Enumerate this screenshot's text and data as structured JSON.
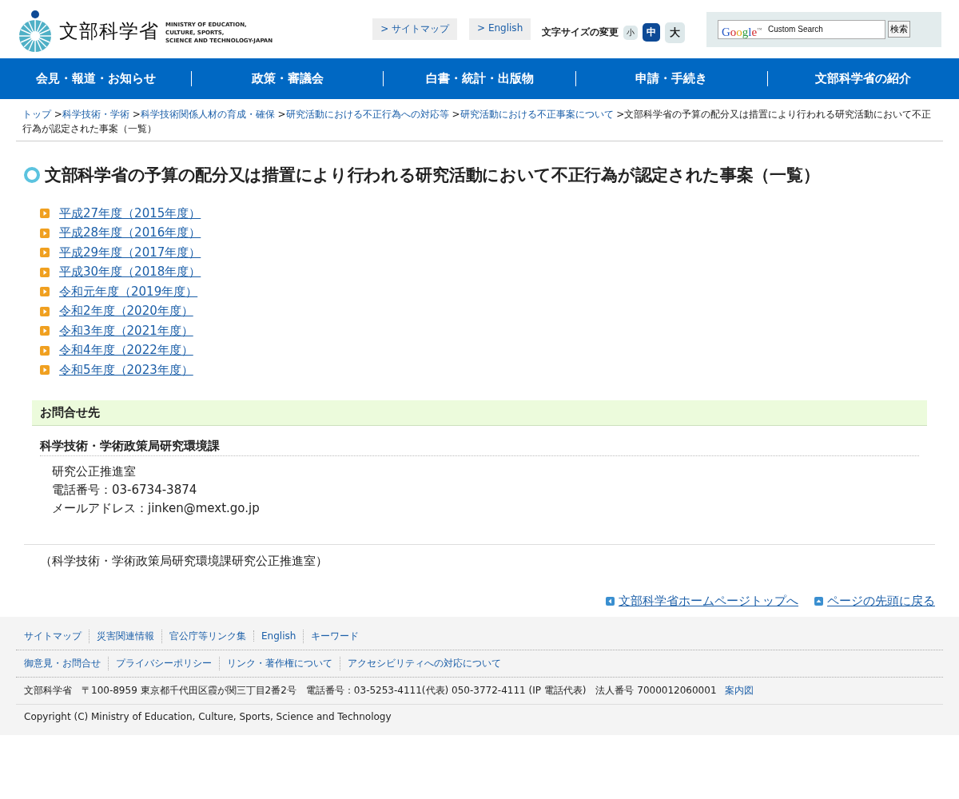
{
  "header": {
    "logo_title": "文部科学省",
    "logo_subtitle": [
      "MINISTRY OF EDUCATION,",
      "CULTURE, SPORTS,",
      "SCIENCE AND TECHNOLOGY-JAPAN"
    ],
    "top_links": [
      "> サイトマップ",
      "> English"
    ],
    "font_size": {
      "label": "文字サイズの変更",
      "options": [
        {
          "label": "小",
          "selected": false
        },
        {
          "label": "中",
          "selected": true
        },
        {
          "label": "大",
          "selected": false
        }
      ]
    },
    "search": {
      "logo": "Google",
      "logo_mark": "™",
      "placeholder": "Custom Search",
      "button": "検索"
    }
  },
  "nav": [
    "会見・報道・お知らせ",
    "政策・審議会",
    "白書・統計・出版物",
    "申請・手続き",
    "文部科学省の紹介"
  ],
  "breadcrumb": {
    "links": [
      "トップ",
      "科学技術・学術",
      "科学技術関係人材の育成・確保",
      "研究活動における不正行為への対応等",
      "研究活動における不正事案について"
    ],
    "separator": ">",
    "current": "文部科学省の予算の配分又は措置により行われる研究活動において不正行為が認定された事案（一覧）"
  },
  "title": "文部科学省の予算の配分又は措置により行われる研究活動において不正行為が認定された事案（一覧）",
  "year_links": [
    "平成27年度（2015年度）",
    "平成28年度（2016年度）",
    "平成29年度（2017年度）",
    "平成30年度（2018年度）",
    "令和元年度（2019年度）",
    "令和2年度（2020年度）",
    "令和3年度（2021年度）",
    "令和4年度（2022年度）",
    "令和5年度（2023年度）"
  ],
  "contact": {
    "heading": "お問合せ先",
    "department": "科学技術・学術政策局研究環境課",
    "lines": [
      "研究公正推進室",
      "電話番号：03-6734-3874",
      "メールアドレス：jinken@mext.go.jp"
    ]
  },
  "source_note": "（科学技術・学術政策局研究環境課研究公正推進室）",
  "page_links": [
    "文部科学省ホームページトップへ",
    "ページの先頭に戻る"
  ],
  "footer": {
    "links_row_1": [
      "サイトマップ",
      "災害関連情報",
      "官公庁等リンク集",
      "English",
      "キーワード"
    ],
    "links_row_2": [
      "御意見・お問合せ",
      "プライバシーポリシー",
      "リンク・著作権について",
      "アクセシビリティへの対応について"
    ],
    "address": "文部科学省　〒100-8959 東京都千代田区霞が関三丁目2番2号　電話番号：03-5253-4111(代表) 050-3772-4111 (IP 電話代表)　法人番号 7000012060001",
    "map_link": "案内図",
    "copyright": "Copyright (C) Ministry of Education, Culture, Sports, Science and Technology"
  }
}
